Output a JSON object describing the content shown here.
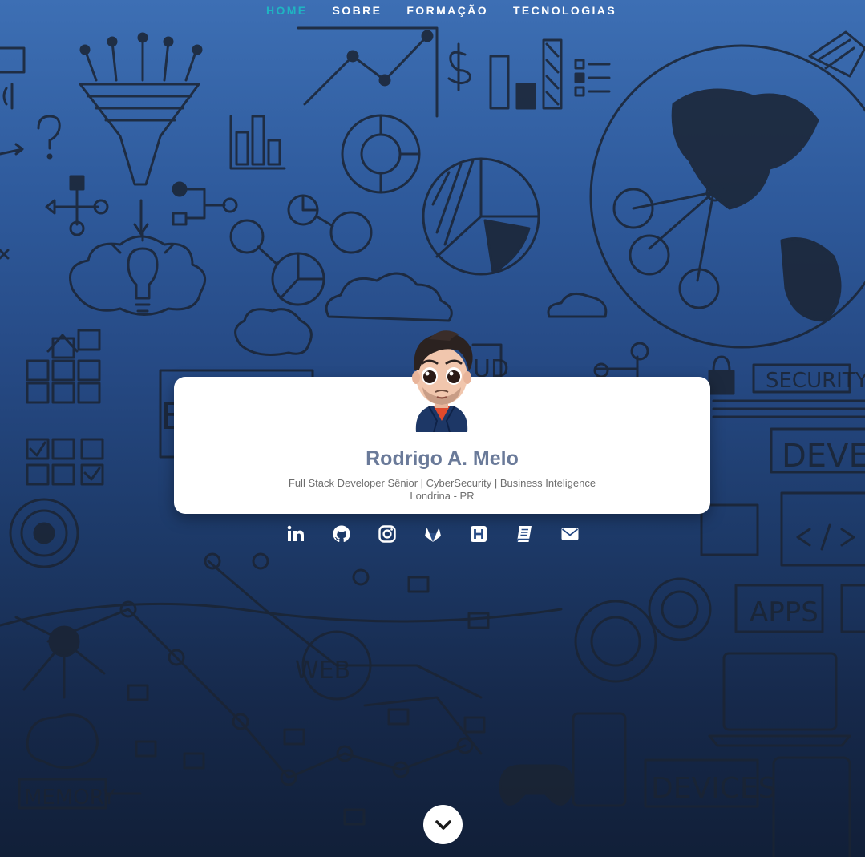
{
  "nav": {
    "items": [
      {
        "label": "HOME",
        "active": true
      },
      {
        "label": "SOBRE",
        "active": false
      },
      {
        "label": "FORMAÇÃO",
        "active": false
      },
      {
        "label": "TECNOLOGIAS",
        "active": false
      }
    ]
  },
  "background": {
    "labels": [
      "SECURITY",
      "DEVELO",
      "APPS",
      "WEB",
      "DEVICES",
      "MEMORY",
      "UD",
      "B"
    ]
  },
  "profile": {
    "name": "Rodrigo A. Melo",
    "role": "Full Stack Developer Sênior | CyberSecurity | Business Inteligence",
    "location": "Londrina - PR"
  },
  "socials": [
    {
      "icon": "linkedin-icon"
    },
    {
      "icon": "github-icon"
    },
    {
      "icon": "instagram-icon"
    },
    {
      "icon": "gitlab-icon"
    },
    {
      "icon": "hackerrank-icon"
    },
    {
      "icon": "book-icon"
    },
    {
      "icon": "email-icon"
    }
  ],
  "colors": {
    "nav_active": "#1fb5c2",
    "name": "#6a7a99",
    "gradient_top": "#3d6fb4",
    "gradient_bottom": "#111f38"
  }
}
